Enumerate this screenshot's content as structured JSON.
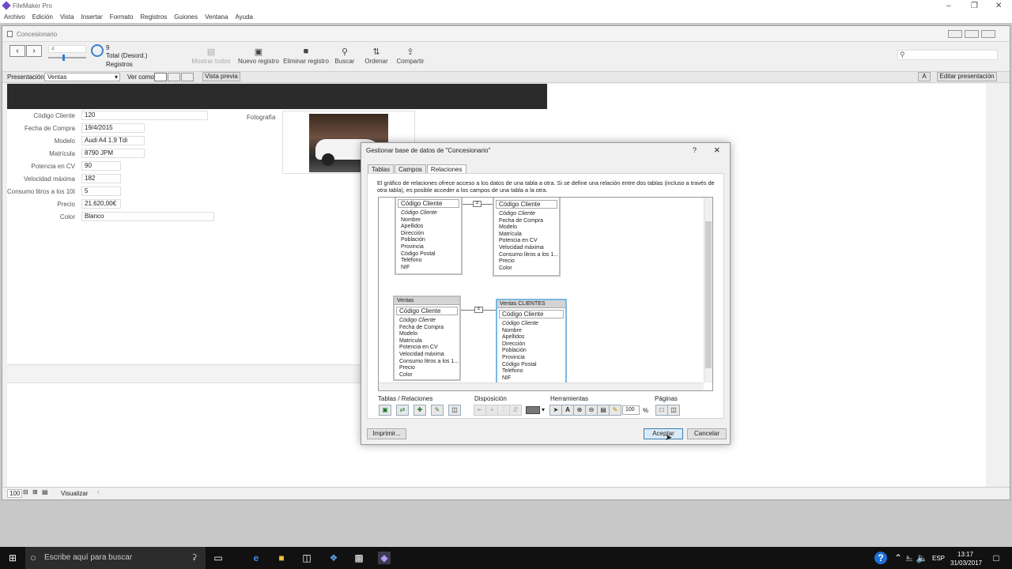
{
  "app": {
    "title": "FileMaker Pro",
    "min_icon": "minimize-icon",
    "max_icon": "restore-icon",
    "close_icon": "close-icon"
  },
  "menu": [
    "Archivo",
    "Edición",
    "Vista",
    "Insertar",
    "Formato",
    "Registros",
    "Guiones",
    "Ventana",
    "Ayuda"
  ],
  "doc": {
    "title": "Concesionario"
  },
  "toolbar": {
    "record_value": "4",
    "found": "9",
    "total": "Total (Desord.)",
    "records": "Registros",
    "show_all": "Mostrar todos",
    "new_record": "Nuevo registro",
    "delete_record": "Eliminar registro",
    "find": "Buscar",
    "sort": "Ordenar",
    "share": "Compartir",
    "search_placeholder": ""
  },
  "layoutbar": {
    "presentation_label": "Presentación:",
    "presentation_value": "Ventas",
    "view_label": "Ver como:",
    "preview": "Vista previa",
    "aa": "A",
    "edit": "Editar presentación"
  },
  "record": {
    "fields": [
      {
        "label": "Código Cliente",
        "value": "120"
      },
      {
        "label": "Fecha de Compra",
        "value": "19/4/2015"
      },
      {
        "label": "Modelo",
        "value": "Audi A4 1.9 Tdi"
      },
      {
        "label": "Matrícula",
        "value": "8790 JPM"
      },
      {
        "label": "Potencia en CV",
        "value": "90"
      },
      {
        "label": "Velocidad máxima",
        "value": "182"
      },
      {
        "label": "Consumo litros a los 100",
        "value": "5"
      },
      {
        "label": "Precio",
        "value": "21.620,00€"
      },
      {
        "label": "Color",
        "value": "Blanco"
      }
    ],
    "photo_label": "Fotografía"
  },
  "statusbar": {
    "zoom": "100",
    "mode": "Visualizar"
  },
  "dialog": {
    "title": "Gestionar base de datos de \"Concesionario\"",
    "help": "?",
    "close": "×",
    "tabs": [
      "Tablas",
      "Campos",
      "Relaciones"
    ],
    "description": "El gráfico de relaciones ofrece acceso a los datos de una tabla a otra. Si se define una relación entre dos tablas (incluso a través de otra tabla), es posible acceder a los campos de una tabla a la otra.",
    "tables": {
      "clientes": {
        "key": "Código Cliente",
        "rows": [
          "Código Cliente",
          "Nombre",
          "Apellidos",
          "Dirección",
          "Población",
          "Provincia",
          "Código Postal",
          "Teléfono",
          "NIF"
        ]
      },
      "clientes_ventas": {
        "key": "Código Cliente",
        "rows": [
          "Código Cliente",
          "Fecha de Compra",
          "Modelo",
          "Matrícula",
          "Potencia en CV",
          "Velocidad máxima",
          "Consumo litros a los 1...",
          "Precio",
          "Color"
        ]
      },
      "ventas": {
        "name": "Ventas",
        "key": "Código Cliente",
        "rows": [
          "Código Cliente",
          "Fecha de Compra",
          "Modelo",
          "Matrícula",
          "Potencia en CV",
          "Velocidad máxima",
          "Consumo litros a los 1...",
          "Precio",
          "Color"
        ]
      },
      "ventas_clientes": {
        "name": "Ventas CLIENTES",
        "key": "Código Cliente",
        "rows": [
          "Código Cliente",
          "Nombre",
          "Apellidos",
          "Dirección",
          "Población",
          "Provincia",
          "Código Postal",
          "Teléfono",
          "NIF"
        ]
      }
    },
    "sections": {
      "tables": "Tablas / Relaciones",
      "layout": "Disposición",
      "tools": "Herramientas",
      "pages": "Páginas"
    },
    "zoom": "100",
    "percent": "%",
    "print": "Imprimir...",
    "ok": "Aceptar",
    "cancel": "Cancelar"
  },
  "taskbar": {
    "search": "Escribe aquí para buscar",
    "lang": "ESP",
    "time": "13:17",
    "date": "31/03/2017"
  }
}
